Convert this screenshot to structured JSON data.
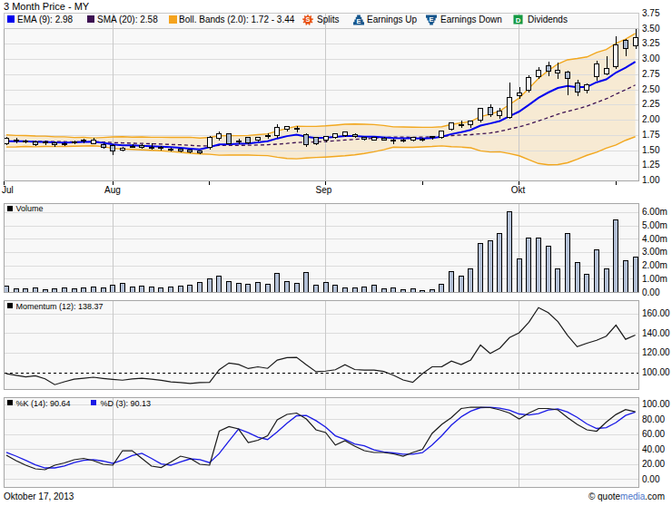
{
  "title": "3 Month Price - MY",
  "colors": {
    "ema": "#0000ee",
    "sma": "#3d1152",
    "boll": "#f2a71e",
    "boll_fill": "rgba(242,167,30,0.17)",
    "candle_up": "#ffffff",
    "candle_down": "#a9b7cc",
    "candle_outline": "#000000",
    "volume_fill": "#b3c0d6",
    "momentum": "#1a1a1a",
    "pctK": "#1a1a1a",
    "pctD": "#1a1ae6",
    "splits_icon": "#e8500f",
    "earnings_icon": "#15558c",
    "dividends_icon": "#169a43"
  },
  "legend": {
    "ema_label": "EMA (9): 2.98",
    "sma_label": "SMA (20): 2.58",
    "boll_label": "Boll. Bands (2.0): 1.72 - 3.44",
    "splits_label": "Splits",
    "earnings_up_label": "Earnings Up",
    "earnings_down_label": "Earnings Down",
    "dividends_label": "Dividends"
  },
  "panels": {
    "volume_label": "Volume",
    "momentum_label": "Momentum (12): 138.37",
    "pctk_label": "%K (14): 90.64",
    "pctd_label": "%D (3): 90.13"
  },
  "axis": {
    "months": [
      "Jul",
      "Aug",
      "Sep",
      "Okt"
    ],
    "price_ticks": [
      "3.75",
      "3.50",
      "3.25",
      "3.00",
      "2.75",
      "2.50",
      "2.25",
      "2.00",
      "1.75",
      "1.50",
      "1.25",
      "1.00"
    ],
    "volume_ticks": [
      "6.00m",
      "5.00m",
      "4.00m",
      "3.00m",
      "2.00m",
      "1.00m",
      "0.00"
    ],
    "momentum_ticks": [
      "160.00",
      "140.00",
      "120.00",
      "100.00"
    ],
    "stochastic_ticks": [
      "100.00",
      "80.00",
      "60.00",
      "40.00",
      "20.00",
      "0.00"
    ]
  },
  "footer": {
    "date": "Oktober 17, 2013",
    "credit_prefix": "© quote",
    "credit_mid": "media",
    "credit_suffix": ".com"
  },
  "chart_data": {
    "type": "candlestick",
    "title": "3 Month Price - MY",
    "x_range": [
      "2013-07-17",
      "2013-10-17"
    ],
    "price_axis": {
      "min": 1.0,
      "max": 3.75,
      "step": 0.25
    },
    "volume_axis_millions": {
      "min": 0,
      "max": 6,
      "step": 1
    },
    "momentum_axis": {
      "min": 100,
      "max": 160,
      "step": 20,
      "reference_line": 100
    },
    "stochastic_axis": {
      "min": 0,
      "max": 100,
      "step": 20
    },
    "indicators": {
      "ema_period": 9,
      "ema_last": 2.98,
      "sma_period": 20,
      "sma_last": 2.58,
      "bollinger": {
        "width": 2.0,
        "last_lower": 1.72,
        "last_upper": 3.44
      },
      "momentum_period": 12,
      "momentum_last": 138.37,
      "pctK_period": 14,
      "pctK_last": 90.64,
      "pctD_period": 3,
      "pctD_last": 90.13
    },
    "series": {
      "dates": [
        "2013-07-17",
        "2013-07-18",
        "2013-07-19",
        "2013-07-22",
        "2013-07-23",
        "2013-07-24",
        "2013-07-25",
        "2013-07-26",
        "2013-07-29",
        "2013-07-30",
        "2013-07-31",
        "2013-08-01",
        "2013-08-02",
        "2013-08-05",
        "2013-08-06",
        "2013-08-07",
        "2013-08-08",
        "2013-08-09",
        "2013-08-12",
        "2013-08-13",
        "2013-08-14",
        "2013-08-15",
        "2013-08-16",
        "2013-08-19",
        "2013-08-20",
        "2013-08-21",
        "2013-08-22",
        "2013-08-23",
        "2013-08-26",
        "2013-08-27",
        "2013-08-28",
        "2013-08-29",
        "2013-08-30",
        "2013-09-03",
        "2013-09-04",
        "2013-09-05",
        "2013-09-06",
        "2013-09-09",
        "2013-09-10",
        "2013-09-11",
        "2013-09-12",
        "2013-09-13",
        "2013-09-16",
        "2013-09-17",
        "2013-09-18",
        "2013-09-19",
        "2013-09-20",
        "2013-09-23",
        "2013-09-24",
        "2013-09-25",
        "2013-09-26",
        "2013-09-27",
        "2013-09-30",
        "2013-10-01",
        "2013-10-02",
        "2013-10-03",
        "2013-10-04",
        "2013-10-07",
        "2013-10-08",
        "2013-10-09",
        "2013-10-10",
        "2013-10-11",
        "2013-10-14",
        "2013-10-15",
        "2013-10-16",
        "2013-10-17"
      ],
      "open": [
        1.62,
        1.67,
        1.655,
        1.64,
        1.63,
        1.625,
        1.605,
        1.635,
        1.66,
        1.62,
        1.6,
        1.59,
        1.51,
        1.56,
        1.58,
        1.56,
        1.55,
        1.53,
        1.52,
        1.51,
        1.49,
        1.55,
        1.7,
        1.77,
        1.66,
        1.72,
        1.67,
        1.74,
        1.74,
        1.85,
        1.87,
        1.76,
        1.72,
        1.67,
        1.72,
        1.75,
        1.76,
        1.72,
        1.68,
        1.7,
        1.67,
        1.67,
        1.67,
        1.69,
        1.71,
        1.72,
        1.85,
        1.92,
        1.92,
        2.0,
        2.21,
        2.07,
        2.05,
        2.41,
        2.5,
        2.72,
        2.9,
        2.78,
        2.79,
        2.62,
        2.49,
        2.72,
        2.77,
        2.88,
        3.32,
        3.22
      ],
      "high": [
        1.72,
        1.71,
        1.68,
        1.66,
        1.66,
        1.65,
        1.64,
        1.67,
        1.69,
        1.71,
        1.62,
        1.6,
        1.56,
        1.61,
        1.6,
        1.62,
        1.58,
        1.55,
        1.53,
        1.52,
        1.5,
        1.74,
        1.81,
        1.78,
        1.7,
        1.73,
        1.72,
        1.78,
        1.935,
        1.91,
        1.9,
        1.78,
        1.73,
        1.74,
        1.79,
        1.81,
        1.78,
        1.73,
        1.73,
        1.72,
        1.69,
        1.7,
        1.72,
        1.71,
        1.74,
        1.83,
        1.96,
        1.99,
        2.0,
        2.21,
        2.26,
        2.2,
        2.62,
        2.54,
        2.74,
        2.88,
        2.96,
        2.95,
        2.81,
        2.66,
        2.6,
        2.98,
        3.05,
        3.38,
        3.34,
        3.5
      ],
      "low": [
        1.59,
        1.62,
        1.62,
        1.58,
        1.59,
        1.56,
        1.58,
        1.6,
        1.62,
        1.6,
        1.53,
        1.43,
        1.48,
        1.54,
        1.53,
        1.52,
        1.5,
        1.48,
        1.47,
        1.45,
        1.44,
        1.52,
        1.67,
        1.6,
        1.61,
        1.6,
        1.65,
        1.7,
        1.71,
        1.82,
        1.8,
        1.56,
        1.59,
        1.64,
        1.7,
        1.73,
        1.71,
        1.66,
        1.66,
        1.66,
        1.61,
        1.64,
        1.65,
        1.65,
        1.68,
        1.7,
        1.83,
        1.87,
        1.88,
        1.96,
        2.06,
        2.03,
        2.02,
        2.36,
        2.46,
        2.68,
        2.72,
        2.68,
        2.41,
        2.4,
        2.44,
        2.65,
        2.74,
        2.84,
        3.06,
        3.18
      ],
      "close": [
        1.7,
        1.66,
        1.65,
        1.6,
        1.64,
        1.6,
        1.62,
        1.65,
        1.67,
        1.67,
        1.55,
        1.49,
        1.54,
        1.57,
        1.55,
        1.55,
        1.54,
        1.51,
        1.5,
        1.48,
        1.47,
        1.71,
        1.77,
        1.62,
        1.65,
        1.63,
        1.71,
        1.735,
        1.88,
        1.89,
        1.86,
        1.6,
        1.62,
        1.73,
        1.78,
        1.8,
        1.73,
        1.69,
        1.72,
        1.68,
        1.66,
        1.68,
        1.71,
        1.68,
        1.73,
        1.82,
        1.95,
        1.93,
        1.99,
        2.19,
        2.09,
        2.15,
        2.38,
        2.45,
        2.7,
        2.83,
        2.81,
        2.83,
        2.69,
        2.46,
        2.58,
        2.93,
        2.86,
        3.24,
        3.18,
        3.36
      ],
      "volume_m": [
        0.47,
        0.27,
        0.27,
        0.34,
        0.2,
        0.27,
        0.34,
        0.27,
        0.34,
        0.4,
        0.34,
        0.54,
        0.68,
        0.4,
        0.47,
        0.4,
        0.34,
        0.4,
        0.47,
        0.54,
        0.74,
        1.0,
        1.2,
        0.8,
        0.68,
        0.6,
        0.74,
        0.6,
        1.4,
        0.8,
        0.68,
        1.5,
        0.54,
        0.74,
        0.54,
        0.37,
        0.37,
        0.44,
        0.54,
        0.27,
        0.37,
        0.2,
        0.27,
        0.14,
        0.2,
        0.61,
        1.56,
        1.22,
        1.8,
        3.7,
        3.9,
        4.45,
        6.05,
        2.55,
        4.1,
        4.1,
        3.48,
        1.77,
        4.41,
        2.24,
        1.37,
        3.17,
        1.77,
        5.41,
        2.39,
        2.66
      ],
      "ema9": [
        1.653,
        1.654,
        1.653,
        1.643,
        1.642,
        1.634,
        1.631,
        1.635,
        1.642,
        1.647,
        1.628,
        1.6,
        1.588,
        1.585,
        1.578,
        1.572,
        1.566,
        1.555,
        1.544,
        1.531,
        1.519,
        1.557,
        1.6,
        1.604,
        1.613,
        1.616,
        1.635,
        1.655,
        1.7,
        1.738,
        1.762,
        1.73,
        1.708,
        1.712,
        1.726,
        1.741,
        1.739,
        1.729,
        1.727,
        1.718,
        1.706,
        1.701,
        1.703,
        1.698,
        1.705,
        1.728,
        1.772,
        1.804,
        1.841,
        1.911,
        1.947,
        1.987,
        2.066,
        2.143,
        2.254,
        2.369,
        2.457,
        2.532,
        2.564,
        2.543,
        2.55,
        2.626,
        2.673,
        2.786,
        2.865,
        2.964
      ],
      "sma20": [
        1.659,
        1.655,
        1.657,
        1.651,
        1.653,
        1.647,
        1.647,
        1.643,
        1.647,
        1.644,
        1.641,
        1.631,
        1.627,
        1.621,
        1.618,
        1.612,
        1.608,
        1.6,
        1.595,
        1.587,
        1.576,
        1.578,
        1.584,
        1.585,
        1.586,
        1.587,
        1.591,
        1.596,
        1.606,
        1.617,
        1.633,
        1.638,
        1.642,
        1.65,
        1.662,
        1.674,
        1.684,
        1.693,
        1.704,
        1.714,
        1.723,
        1.722,
        1.719,
        1.722,
        1.726,
        1.735,
        1.747,
        1.757,
        1.762,
        1.777,
        1.789,
        1.817,
        1.854,
        1.891,
        1.936,
        1.988,
        2.042,
        2.099,
        2.147,
        2.186,
        2.232,
        2.295,
        2.353,
        2.43,
        2.503,
        2.58
      ],
      "bb_upper": [
        1.758,
        1.749,
        1.748,
        1.739,
        1.738,
        1.727,
        1.726,
        1.715,
        1.718,
        1.708,
        1.716,
        1.725,
        1.729,
        1.722,
        1.724,
        1.719,
        1.719,
        1.717,
        1.718,
        1.719,
        1.706,
        1.717,
        1.744,
        1.745,
        1.746,
        1.749,
        1.762,
        1.776,
        1.823,
        1.866,
        1.9,
        1.898,
        1.899,
        1.907,
        1.92,
        1.934,
        1.937,
        1.933,
        1.928,
        1.913,
        1.891,
        1.89,
        1.886,
        1.884,
        1.884,
        1.893,
        1.93,
        1.956,
        1.98,
        2.06,
        2.101,
        2.153,
        2.259,
        2.366,
        2.525,
        2.689,
        2.818,
        2.928,
        2.996,
        3.017,
        3.043,
        3.118,
        3.164,
        3.268,
        3.337,
        3.431
      ],
      "bb_lower": [
        1.559,
        1.561,
        1.567,
        1.563,
        1.568,
        1.566,
        1.568,
        1.572,
        1.575,
        1.58,
        1.566,
        1.536,
        1.525,
        1.52,
        1.512,
        1.505,
        1.497,
        1.484,
        1.471,
        1.455,
        1.445,
        1.439,
        1.424,
        1.425,
        1.425,
        1.425,
        1.421,
        1.416,
        1.39,
        1.369,
        1.365,
        1.378,
        1.386,
        1.393,
        1.403,
        1.414,
        1.43,
        1.452,
        1.48,
        1.514,
        1.556,
        1.553,
        1.552,
        1.56,
        1.567,
        1.578,
        1.565,
        1.558,
        1.545,
        1.495,
        1.477,
        1.48,
        1.45,
        1.415,
        1.348,
        1.287,
        1.266,
        1.27,
        1.299,
        1.356,
        1.422,
        1.472,
        1.541,
        1.593,
        1.669,
        1.729
      ],
      "momentum12": [
        99.0,
        97.3,
        95.8,
        96.8,
        93.8,
        87.8,
        90.8,
        93.4,
        94.4,
        95.4,
        94.2,
        93.2,
        92.4,
        93.6,
        94.4,
        93.4,
        92.2,
        90.6,
        90.0,
        89.0,
        90.0,
        90.2,
        103.0,
        109.8,
        108.4,
        104.2,
        106.0,
        104.4,
        112.8,
        115.4,
        115.6,
        108.0,
        101.0,
        101.6,
        103.0,
        108.2,
        103.2,
        102.6,
        102.6,
        101.2,
        97.5,
        92.6,
        90.2,
        99.0,
        106.0,
        106.2,
        111.8,
        108.2,
        113.0,
        128.2,
        119.6,
        125.0,
        135.7,
        140.7,
        151.4,
        166.3,
        161.2,
        152.0,
        138.0,
        126.5,
        130.0,
        133.0,
        137.2,
        148.4,
        134.0,
        138.37
      ],
      "pctK": [
        32.4,
        25.1,
        19.0,
        14.1,
        12.9,
        19.0,
        22.0,
        26.3,
        28.1,
        25.1,
        20.2,
        19.0,
        38.4,
        38.4,
        28.1,
        17.8,
        15.9,
        23.2,
        31.1,
        28.1,
        20.2,
        19.0,
        64.6,
        70.7,
        67.6,
        49.4,
        52.4,
        58.5,
        79.8,
        87.1,
        88.9,
        81.0,
        66.4,
        62.8,
        46.0,
        52.0,
        44.5,
        38.4,
        36.0,
        36.0,
        34.2,
        31.1,
        36.0,
        40.3,
        61.6,
        73.7,
        82.8,
        95.0,
        96.8,
        96.8,
        96.2,
        93.2,
        88.9,
        81.0,
        88.9,
        95.0,
        95.0,
        93.2,
        82.8,
        73.7,
        66.4,
        64.6,
        76.7,
        87.0,
        93.5,
        90.64
      ],
      "pctD": [
        36.13,
        31.17,
        25.5,
        19.4,
        15.33,
        15.33,
        17.97,
        22.43,
        25.47,
        26.5,
        24.47,
        21.43,
        25.87,
        31.93,
        34.97,
        28.1,
        20.6,
        18.97,
        23.4,
        27.47,
        26.47,
        22.43,
        34.6,
        51.43,
        67.63,
        62.57,
        56.47,
        53.43,
        63.57,
        75.13,
        85.27,
        85.67,
        78.77,
        70.07,
        58.4,
        53.6,
        47.5,
        44.97,
        39.63,
        36.8,
        35.4,
        33.77,
        33.77,
        35.8,
        45.97,
        58.53,
        72.7,
        83.83,
        91.53,
        96.2,
        96.6,
        95.4,
        92.77,
        87.7,
        86.27,
        88.3,
        92.97,
        94.4,
        90.33,
        83.23,
        74.3,
        68.23,
        69.23,
        76.1,
        85.73,
        90.38
      ]
    }
  }
}
